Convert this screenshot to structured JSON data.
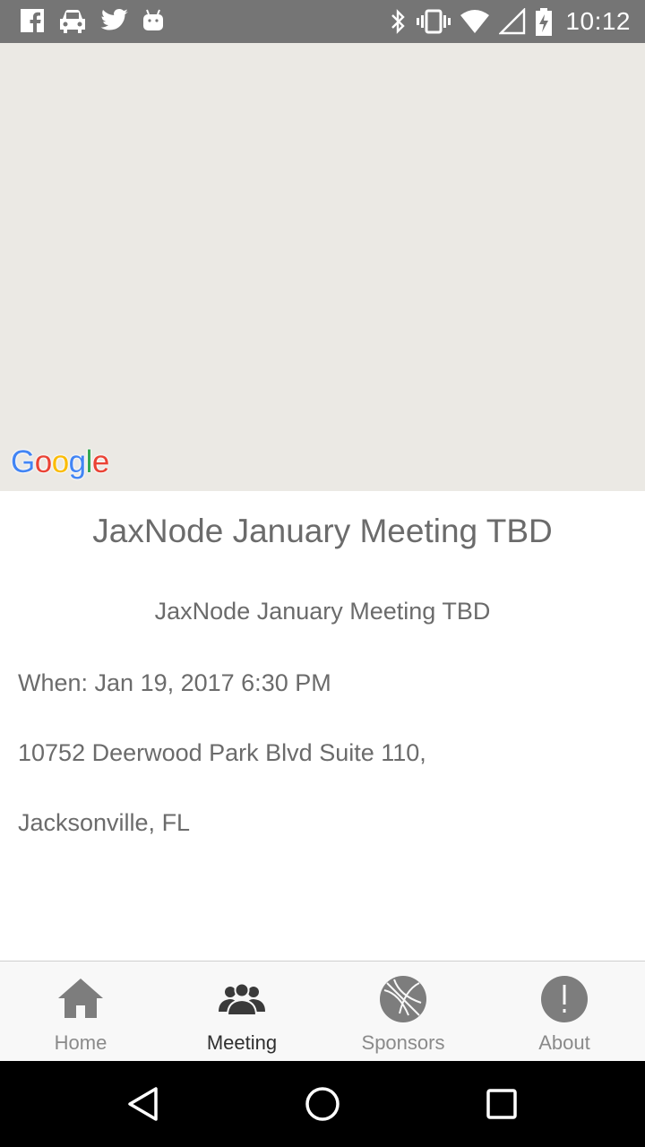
{
  "status_bar": {
    "time": "10:12",
    "left_icons": [
      "facebook-icon",
      "car-icon",
      "twitter-icon",
      "android-icon"
    ],
    "right_icons": [
      "bluetooth-icon",
      "vibrate-icon",
      "wifi-icon",
      "signal-icon",
      "battery-charging-icon"
    ]
  },
  "map": {
    "attribution": {
      "G": "G",
      "o1": "o",
      "o2": "o",
      "g": "g",
      "l": "l",
      "e": "e"
    }
  },
  "meeting": {
    "title": "JaxNode January Meeting TBD",
    "subtitle": "JaxNode January Meeting TBD",
    "when": "When: Jan 19, 2017 6:30 PM",
    "address_line1": "10752 Deerwood Park Blvd Suite 110,",
    "address_line2": "Jacksonville, FL"
  },
  "tabs": [
    {
      "label": "Home",
      "icon": "home-icon",
      "active": false
    },
    {
      "label": "Meeting",
      "icon": "people-icon",
      "active": true
    },
    {
      "label": "Sponsors",
      "icon": "basketball-icon",
      "active": false
    },
    {
      "label": "About",
      "icon": "exclamation-icon",
      "active": false
    }
  ],
  "colors": {
    "status_bar": "#757575",
    "map_background": "#ebe9e4",
    "text": "#6b6b6b",
    "tab_active": "#2f2f2f",
    "tab_inactive": "#8a8a8a",
    "nav_bar": "#000000"
  }
}
